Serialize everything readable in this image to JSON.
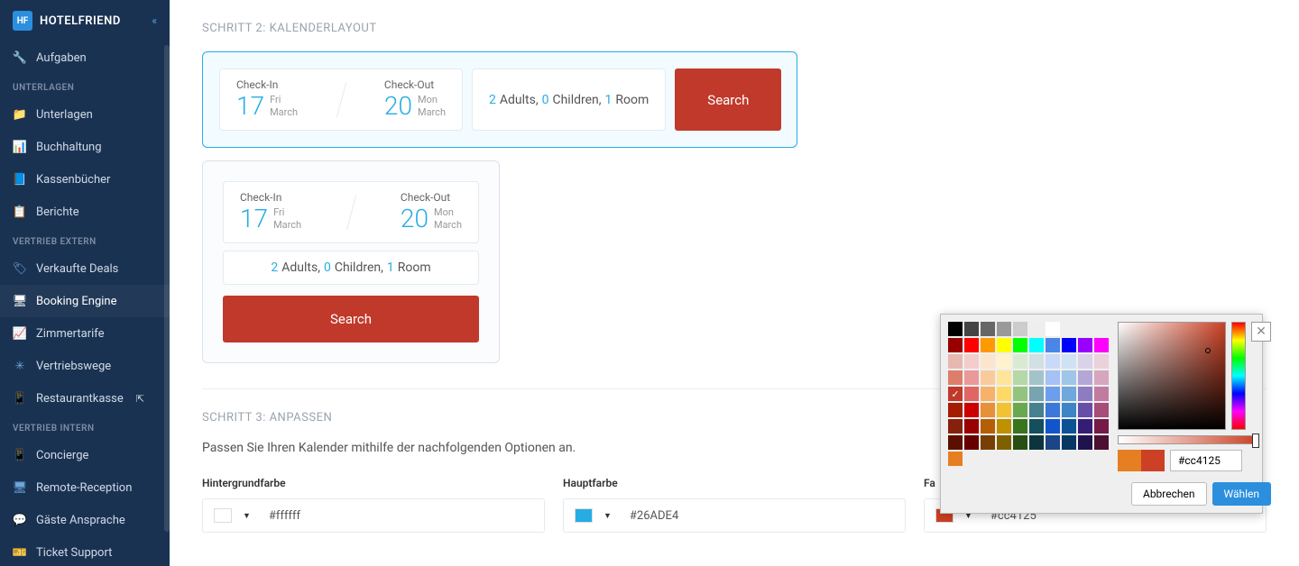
{
  "brand": {
    "name": "HOTELFRIEND",
    "mark": "HF"
  },
  "sidebar": {
    "top_item": {
      "label": "Aufgaben",
      "icon": "🔧"
    },
    "sections": [
      {
        "title": "UNTERLAGEN",
        "items": [
          {
            "label": "Unterlagen",
            "icon": "📁"
          },
          {
            "label": "Buchhaltung",
            "icon": "📊"
          },
          {
            "label": "Kassenbücher",
            "icon": "📘"
          },
          {
            "label": "Berichte",
            "icon": "📋"
          }
        ]
      },
      {
        "title": "VERTRIEB EXTERN",
        "items": [
          {
            "label": "Verkaufte Deals",
            "icon": "🏷"
          },
          {
            "label": "Booking Engine",
            "icon": "🖥",
            "active": true
          },
          {
            "label": "Zimmertarife",
            "icon": "📈"
          },
          {
            "label": "Vertriebswege",
            "icon": "✳"
          },
          {
            "label": "Restaurantkasse",
            "icon": "📱",
            "ext": true
          }
        ]
      },
      {
        "title": "VERTRIEB INTERN",
        "items": [
          {
            "label": "Concierge",
            "icon": "📱"
          },
          {
            "label": "Remote-Reception",
            "icon": "🖥"
          },
          {
            "label": "Gäste Ansprache",
            "icon": "💬"
          },
          {
            "label": "Ticket Support",
            "icon": "🎫"
          }
        ]
      }
    ]
  },
  "step2": {
    "title": "SCHRITT 2: KALENDERLAYOUT",
    "checkin_label": "Check-In",
    "checkout_label": "Check-Out",
    "checkin_day": "17",
    "checkin_dow": "Fri",
    "checkin_month": "March",
    "checkout_day": "20",
    "checkout_dow": "Mon",
    "checkout_month": "March",
    "adults_n": "2",
    "adults_t": " Adults, ",
    "children_n": "0",
    "children_t": " Children, ",
    "room_n": "1",
    "room_t": " Room",
    "search": "Search"
  },
  "step3": {
    "title": "SCHRITT 3: ANPASSEN",
    "desc": "Passen Sie Ihren Kalender mithilfe der nachfolgenden Optionen an.",
    "bg_label": "Hintergrundfarbe",
    "bg_value": "#ffffff",
    "main_label": "Hauptfarbe",
    "main_value": "#26ADE4",
    "btn_label": "Fa",
    "btn_value": "#cc4125",
    "colors": {
      "bg": "#ffffff",
      "main": "#26ADE4",
      "btn": "#cc4125"
    }
  },
  "picker": {
    "hex": "#cc4125",
    "cancel": "Abbrechen",
    "choose": "Wählen",
    "preview_old": "#e67e22",
    "preview_new": "#cc4125",
    "rows": [
      [
        "#000000",
        "#444444",
        "#666666",
        "#999999",
        "#cccccc",
        "#eeeeee",
        "#ffffff"
      ],
      [
        "#980000",
        "#ff0000",
        "#ff9900",
        "#ffff00",
        "#00ff00",
        "#00ffff",
        "#4a86e8",
        "#0000ff",
        "#9900ff",
        "#ff00ff"
      ],
      [
        "#e6b8af",
        "#f4cccc",
        "#fce5cd",
        "#fff2cc",
        "#d9ead3",
        "#d0e0e3",
        "#c9daf8",
        "#cfe2f3",
        "#d9d2e9",
        "#ead1dc"
      ],
      [
        "#dd7e6b",
        "#ea9999",
        "#f9cb9c",
        "#ffe599",
        "#b6d7a8",
        "#a2c4c9",
        "#a4c2f4",
        "#9fc5e8",
        "#b4a7d6",
        "#d5a6bd"
      ],
      [
        "#cc4125",
        "#e06666",
        "#f6b26b",
        "#ffd966",
        "#93c47d",
        "#76a5af",
        "#6d9eeb",
        "#6fa8dc",
        "#8e7cc3",
        "#c27ba0"
      ],
      [
        "#a61c00",
        "#cc0000",
        "#e69138",
        "#f1c232",
        "#6aa84f",
        "#45818e",
        "#3c78d8",
        "#3d85c6",
        "#674ea7",
        "#a64d79"
      ],
      [
        "#85200c",
        "#990000",
        "#b45f06",
        "#bf9000",
        "#38761d",
        "#134f5c",
        "#1155cc",
        "#0b5394",
        "#351c75",
        "#741b47"
      ],
      [
        "#5b0f00",
        "#660000",
        "#783f04",
        "#7f6000",
        "#274e13",
        "#0c343d",
        "#1c4587",
        "#073763",
        "#20124d",
        "#4c1130"
      ],
      [
        "#e67e22"
      ]
    ]
  }
}
